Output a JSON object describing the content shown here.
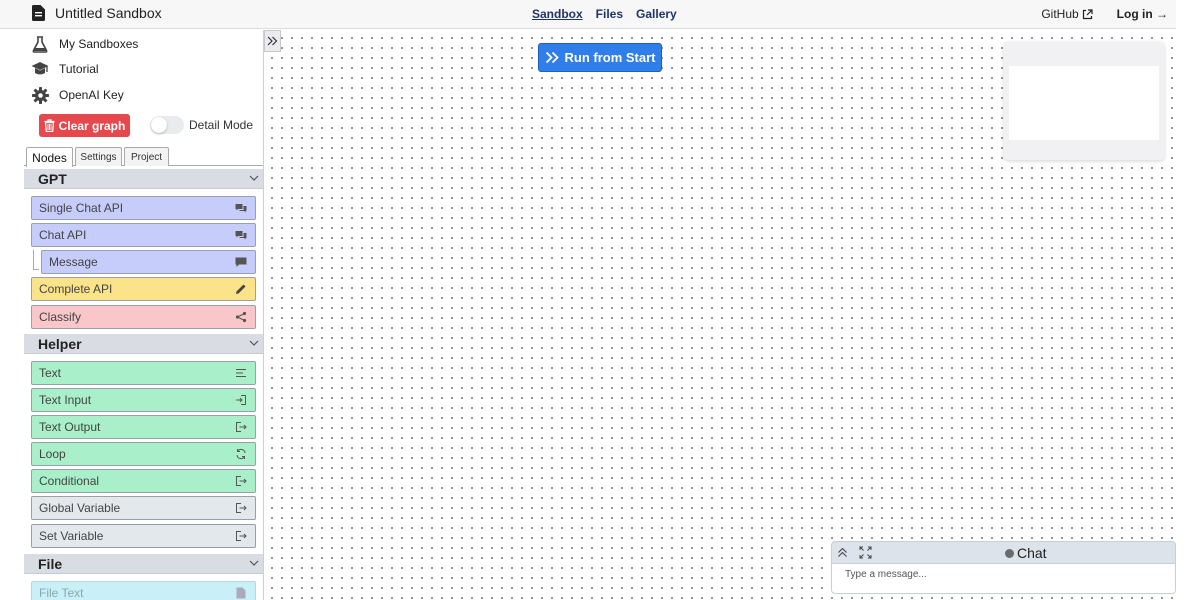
{
  "header": {
    "app_title": "Untitled Sandbox",
    "nav": [
      {
        "label": "Sandbox",
        "active": true
      },
      {
        "label": "Files",
        "active": false
      },
      {
        "label": "Gallery",
        "active": false
      }
    ],
    "github_label": "GitHub",
    "login_label": "Log in →"
  },
  "sidebar": {
    "menu": [
      {
        "label": "My Sandboxes",
        "icon": "flask-icon"
      },
      {
        "label": "Tutorial",
        "icon": "graduation-cap-icon"
      },
      {
        "label": "OpenAI Key",
        "icon": "gear-icon"
      }
    ],
    "clear_label": "Clear graph",
    "detail_mode_label": "Detail Mode",
    "detail_mode_on": false,
    "tabs": [
      "Nodes",
      "Settings",
      "Project"
    ],
    "active_tab": "Nodes",
    "sections": {
      "gpt": {
        "title": "GPT",
        "nodes": [
          "Single Chat API",
          "Chat API",
          "Message",
          "Complete API",
          "Classify"
        ]
      },
      "helper": {
        "title": "Helper",
        "nodes": [
          "Text",
          "Text Input",
          "Text Output",
          "Loop",
          "Conditional",
          "Global Variable",
          "Set Variable"
        ]
      },
      "file": {
        "title": "File",
        "nodes": [
          "File Text"
        ]
      }
    }
  },
  "canvas": {
    "run_label": "Run from Start"
  },
  "chat": {
    "title": "Chat",
    "placeholder": "Type a message..."
  },
  "colors": {
    "run_button": "#2f7eea",
    "clear_button": "#e5484d",
    "gpt_node": "#c7cdfb",
    "complete_node": "#fbe38a",
    "classify_node": "#f9c6ca",
    "helper_node": "#a9efc9",
    "file_node": "#c9eff8"
  }
}
